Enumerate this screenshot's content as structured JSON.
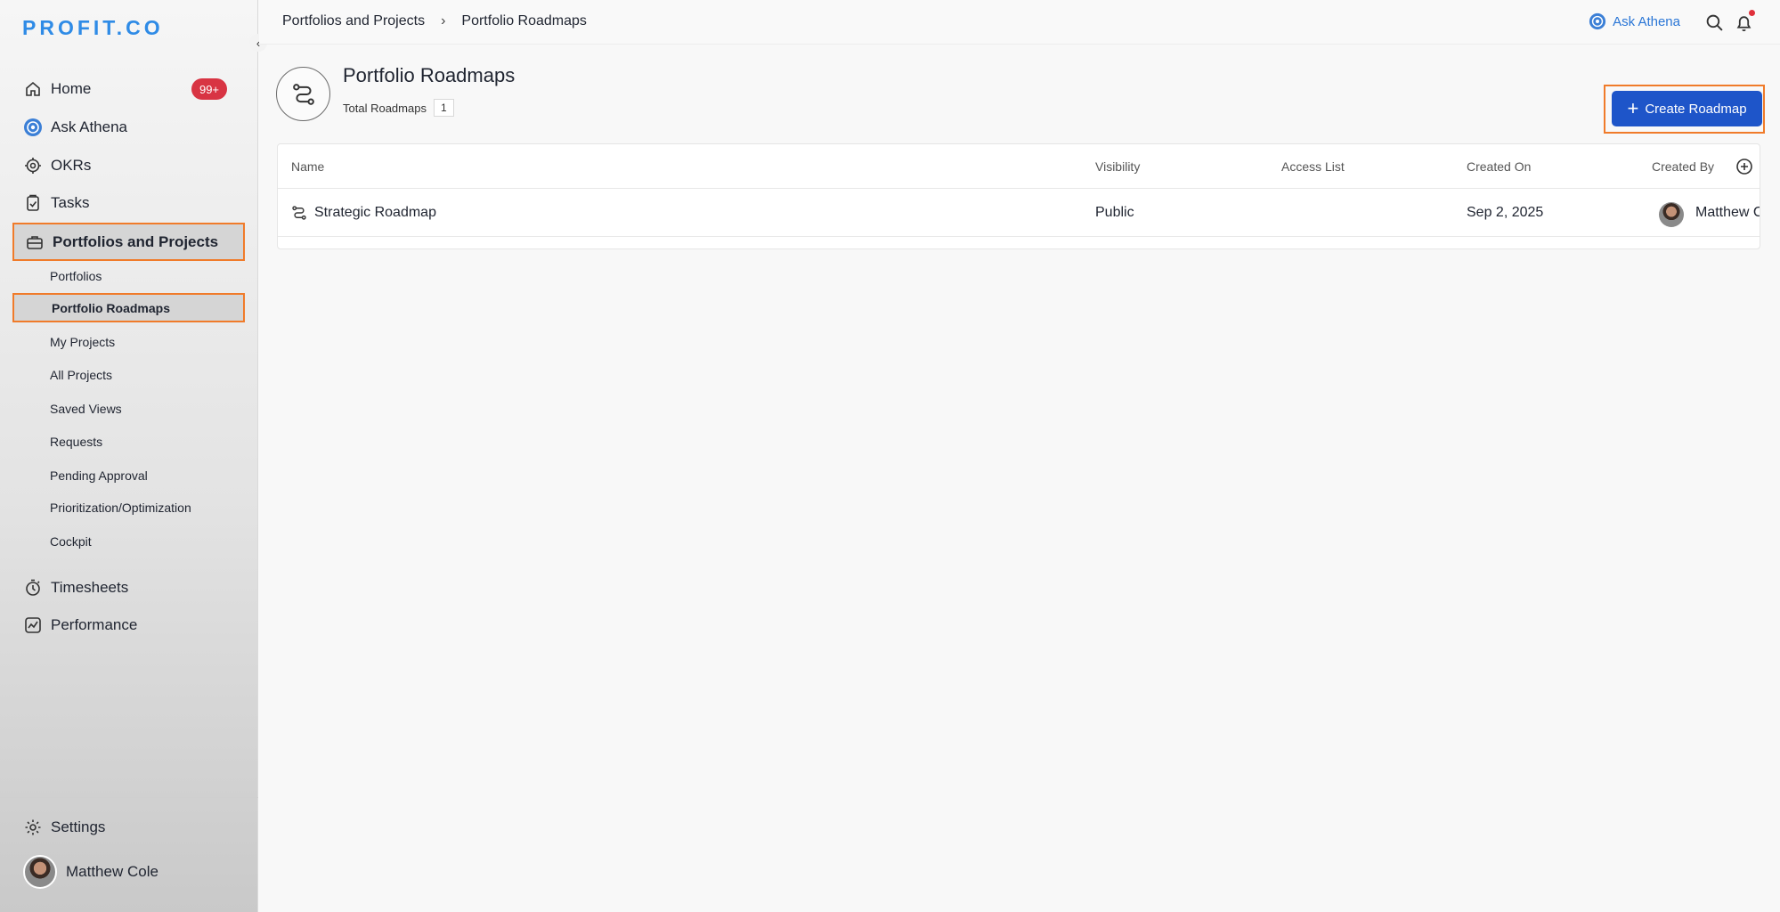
{
  "sidebar": {
    "logo": "PROFIT.CO",
    "nav": [
      {
        "label": "Home",
        "icon": "home-icon",
        "badge": "99+"
      },
      {
        "label": "Ask Athena",
        "icon": "athena-icon"
      },
      {
        "label": "OKRs",
        "icon": "target-icon"
      },
      {
        "label": "Tasks",
        "icon": "clipboard-check-icon"
      },
      {
        "label": "Portfolios and Projects",
        "icon": "briefcase-icon"
      }
    ],
    "sub_items": [
      "Portfolios",
      "Portfolio Roadmaps",
      "My Projects",
      "All Projects",
      "Saved Views",
      "Requests",
      "Pending Approval",
      "Prioritization/Optimization",
      "Cockpit"
    ],
    "nav_bottom": [
      {
        "label": "Timesheets",
        "icon": "stopwatch-icon"
      },
      {
        "label": "Performance",
        "icon": "chart-line-icon"
      }
    ],
    "settings": {
      "label": "Settings",
      "icon": "gear-icon"
    },
    "user": {
      "name": "Matthew Cole"
    }
  },
  "topbar": {
    "breadcrumb": [
      "Portfolios and Projects",
      "Portfolio Roadmaps"
    ],
    "separator": "›",
    "ask_label": "Ask Athena"
  },
  "header": {
    "title": "Portfolio Roadmaps",
    "total_label": "Total Roadmaps",
    "total_count": "1",
    "create_label": "Create Roadmap"
  },
  "table": {
    "columns": [
      "Name",
      "Visibility",
      "Access List",
      "Created On",
      "Created By"
    ],
    "rows": [
      {
        "name": "Strategic Roadmap",
        "visibility": "Public",
        "access_list": "",
        "created_on": "Sep 2, 2025",
        "created_by": "Matthew C"
      }
    ]
  },
  "colors": {
    "accent": "#1e55c9",
    "highlight": "#f07b2a",
    "badge": "#d83443",
    "link": "#2a76d6"
  }
}
